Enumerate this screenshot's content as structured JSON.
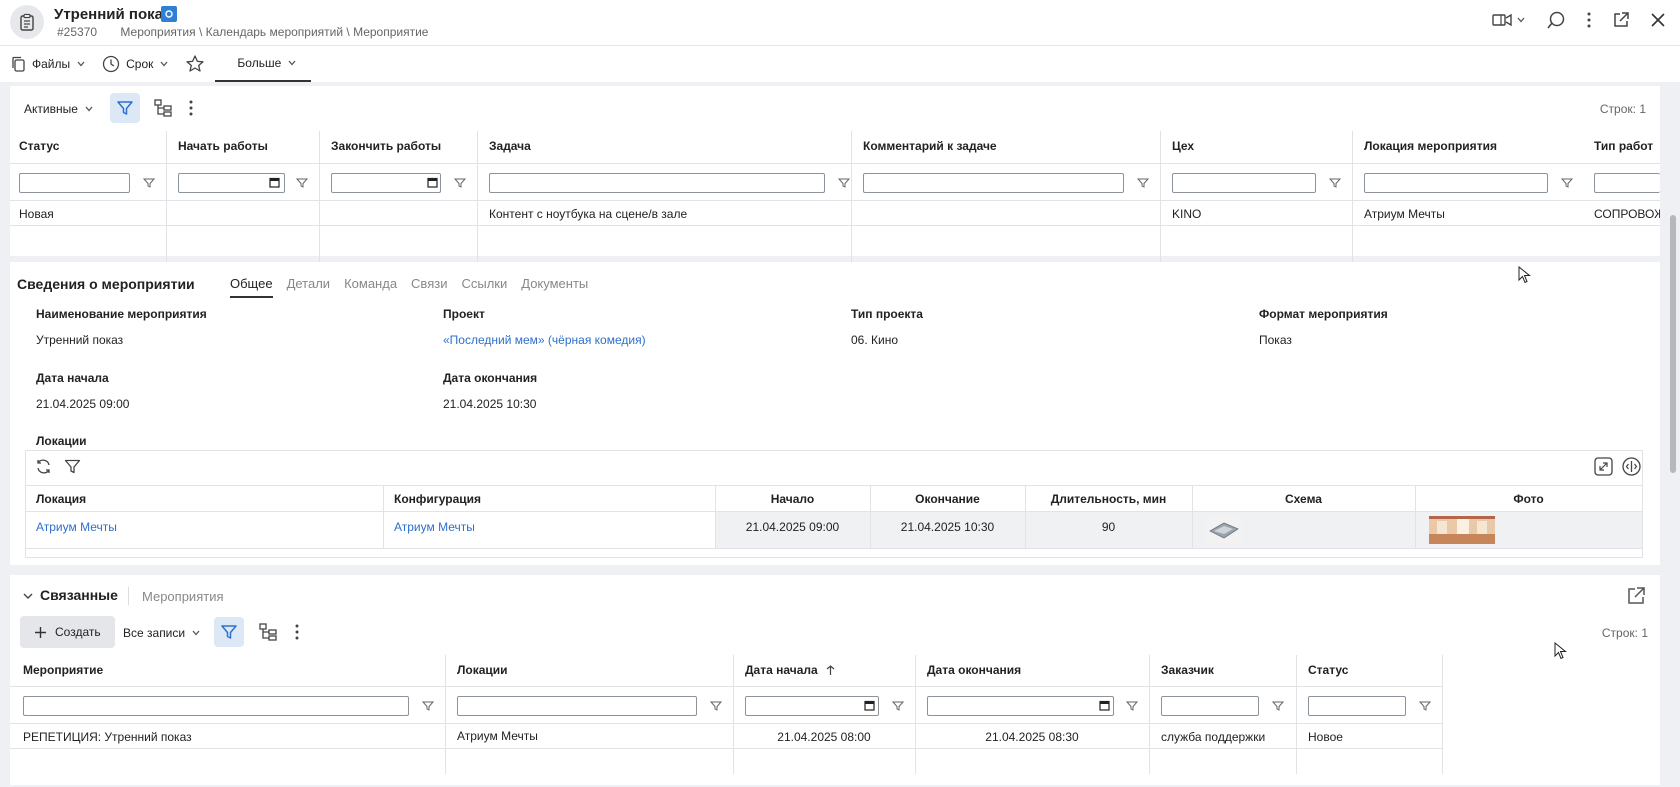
{
  "header": {
    "title": "Утренний показ",
    "id": "#25370",
    "breadcrumb": "Мероприятия \\ Календарь мероприятий \\ Мероприятие"
  },
  "toolbar": {
    "files": "Файлы",
    "deadline": "Срок",
    "more": "Больше"
  },
  "tasks": {
    "view": "Активные",
    "rows_count": "Строк: 1",
    "columns": [
      "Статус",
      "Начать работы",
      "Закончить работы",
      "Задача",
      "Комментарий к задаче",
      "Цех",
      "Локация мероприятия",
      "Тип работ"
    ],
    "row": {
      "status": "Новая",
      "start": "",
      "end": "",
      "task": "Контент с ноутбука на сцене/в зале",
      "comment": "",
      "workshop": "KINO",
      "location": "Атриум Мечты",
      "work_type": "СОПРОВОЖ"
    }
  },
  "event": {
    "section_title": "Сведения о мероприятии",
    "tabs": [
      "Общее",
      "Детали",
      "Команда",
      "Связи",
      "Ссылки",
      "Документы"
    ],
    "fields": {
      "name_label": "Наименование мероприятия",
      "name_value": "Утренний показ",
      "project_label": "Проект",
      "project_value": "«Последний мем» (чёрная комедия)",
      "project_type_label": "Тип проекта",
      "project_type_value": "06. Кино",
      "format_label": "Формат мероприятия",
      "format_value": "Показ",
      "start_label": "Дата начала",
      "start_value": "21.04.2025 09:00",
      "end_label": "Дата окончания",
      "end_value": "21.04.2025 10:30",
      "locations_label": "Локации"
    },
    "locations": {
      "columns": [
        "Локация",
        "Конфигурация",
        "Начало",
        "Окончание",
        "Длительность, мин",
        "Схема",
        "Фото"
      ],
      "row": {
        "location": "Атриум Мечты",
        "config": "Атриум Мечты",
        "start": "21.04.2025 09:00",
        "end": "21.04.2025 10:30",
        "duration": "90"
      }
    }
  },
  "related": {
    "title": "Связанные",
    "subtitle": "Мероприятия",
    "create": "Создать",
    "view": "Все записи",
    "rows_count": "Строк: 1",
    "columns": [
      "Мероприятие",
      "Локации",
      "Дата начала",
      "Дата окончания",
      "Заказчик",
      "Статус"
    ],
    "row": {
      "event": "РЕПЕТИЦИЯ: Утренний показ",
      "locations": "Атриум Мечты",
      "start": "21.04.2025 08:00",
      "end": "21.04.2025 08:30",
      "customer": "служба поддержки",
      "status": "Новое"
    }
  },
  "colors": {
    "accent": "#2f6fcc",
    "filter_active_bg": "#dde8f7",
    "sync_badge": "#2f7fd6"
  }
}
